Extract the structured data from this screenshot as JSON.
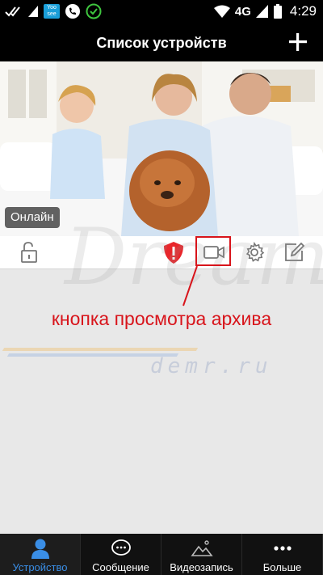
{
  "status_bar": {
    "network": "4G",
    "time": "4:29",
    "app_badge": [
      "Yoo",
      "see"
    ],
    "icons": [
      "double-check-icon",
      "app-icon",
      "phone-icon",
      "check-circle-icon",
      "wifi-icon",
      "signal-icon",
      "battery-icon"
    ]
  },
  "header": {
    "title": "Список устройств",
    "add_icon": "plus-icon"
  },
  "device": {
    "status": "Онлайн",
    "tools": [
      "unlock-icon",
      "alert-shield-icon",
      "video-camera-icon",
      "gear-icon",
      "edit-icon"
    ]
  },
  "annotation": {
    "text": "кнопка просмотра архива"
  },
  "watermark": {
    "big": "Dreamers",
    "small": "demr.ru"
  },
  "bottom_nav": {
    "items": [
      {
        "label": "Устройство",
        "icon": "person-icon",
        "active": true
      },
      {
        "label": "Сообщение",
        "icon": "chat-icon",
        "active": false
      },
      {
        "label": "Видеозапись",
        "icon": "landscape-icon",
        "active": false
      },
      {
        "label": "Больше",
        "icon": "more-icon",
        "active": false
      }
    ]
  },
  "colors": {
    "accent": "#3a8ee6",
    "annotation": "#d8141b",
    "shield": "#e8262b"
  }
}
